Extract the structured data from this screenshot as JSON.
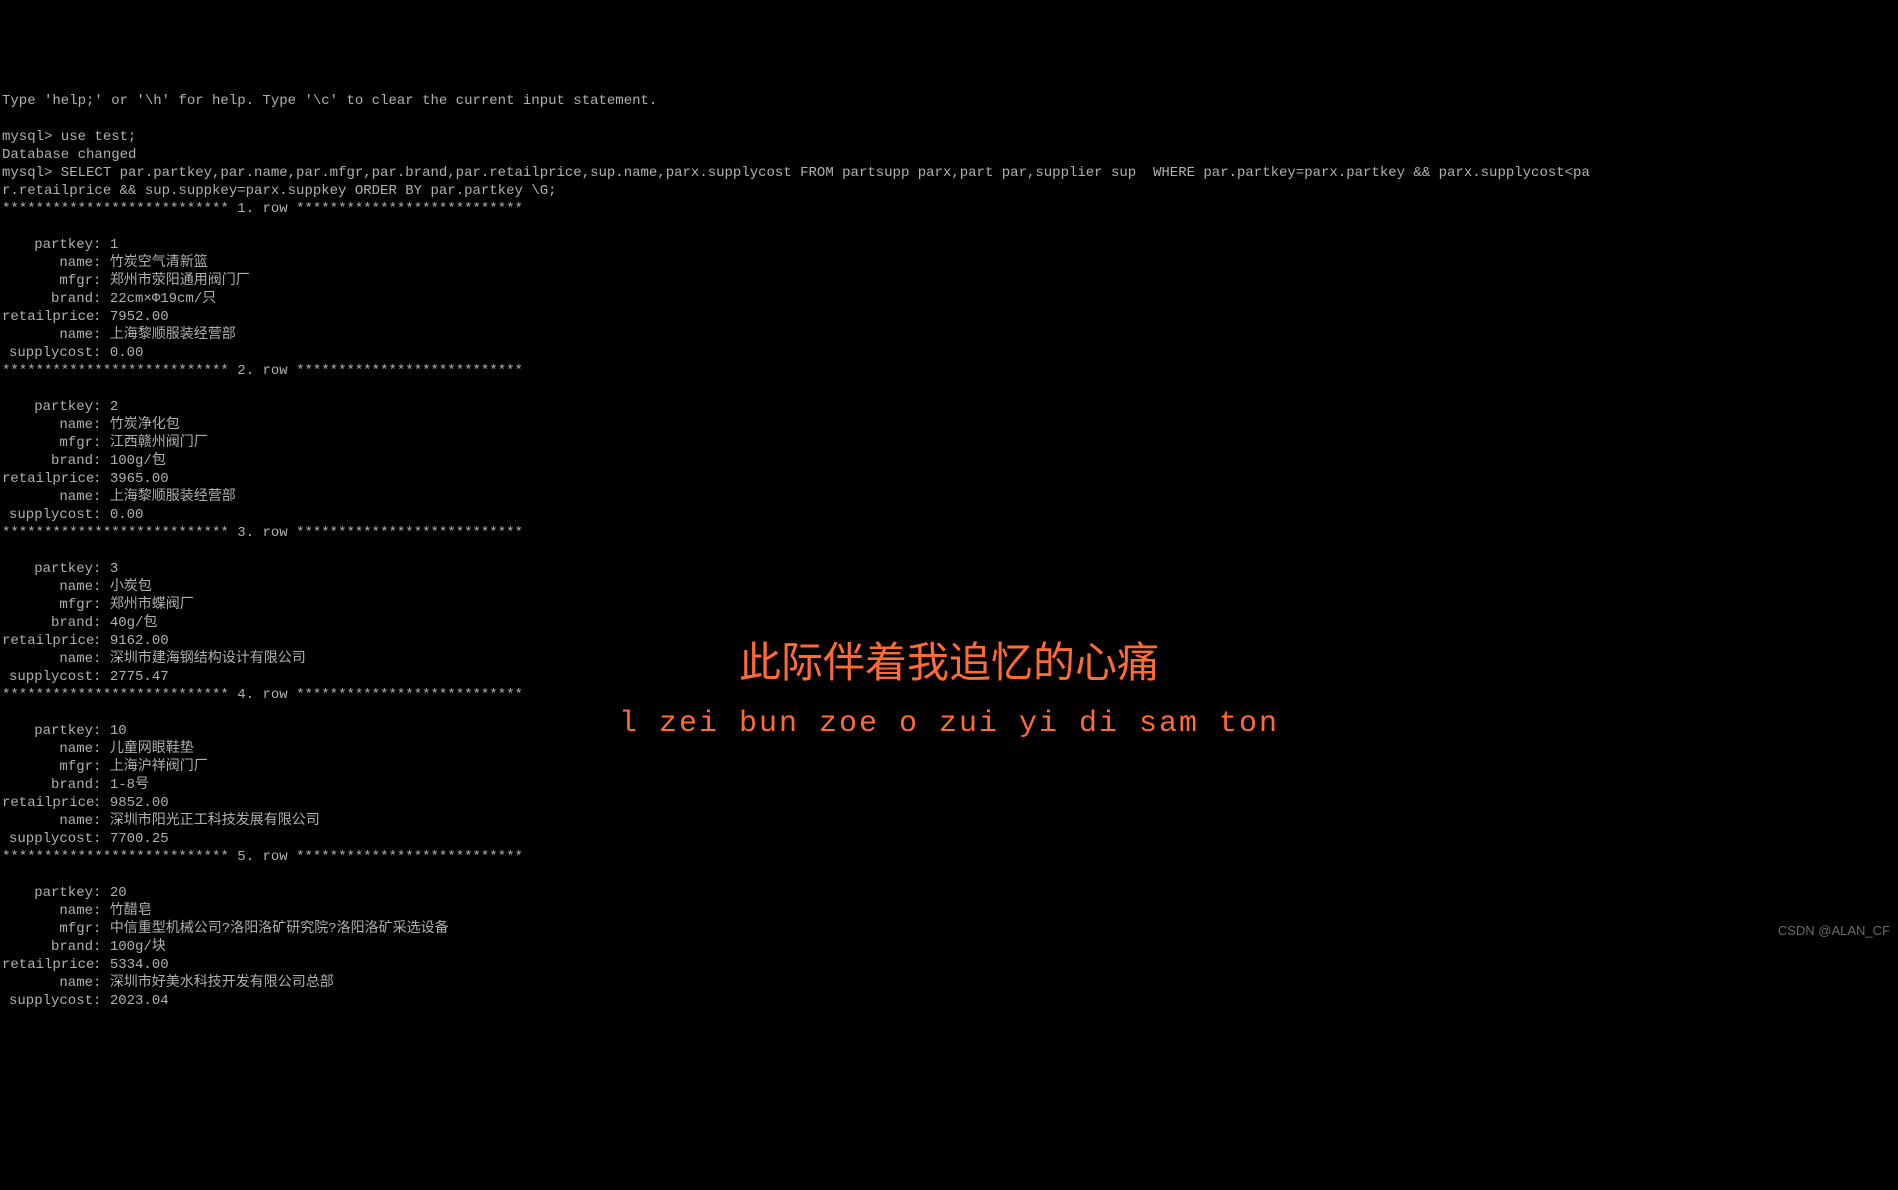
{
  "help_line": "Type 'help;' or '\\h' for help. Type '\\c' to clear the current input statement.",
  "blank": "",
  "prompt1": "mysql> use test;",
  "db_changed": "Database changed",
  "query_line1": "mysql> SELECT par.partkey,par.name,par.mfgr,par.brand,par.retailprice,sup.name,parx.supplycost FROM partsupp parx,part par,supplier sup  WHERE par.partkey=parx.partkey && parx.supplycost<pa",
  "query_line2": "r.retailprice && sup.suppkey=parx.suppkey ORDER BY par.partkey \\G;",
  "sep_prefix": "***************************",
  "sep_suffix": " ***************************",
  "row_label": ". row",
  "rows": [
    {
      "n": "1",
      "partkey": "1",
      "name": "竹炭空气清新篮",
      "mfgr": "郑州市荥阳通用阀门厂",
      "brand": "22cm×Φ19cm/只",
      "retailprice": "7952.00",
      "sup_name": "上海黎顺服装经营部",
      "supplycost": "0.00"
    },
    {
      "n": "2",
      "partkey": "2",
      "name": "竹炭净化包",
      "mfgr": "江西赣州阀门厂",
      "brand": "100g/包",
      "retailprice": "3965.00",
      "sup_name": "上海黎顺服装经营部",
      "supplycost": "0.00"
    },
    {
      "n": "3",
      "partkey": "3",
      "name": "小炭包",
      "mfgr": "郑州市蝶阀厂",
      "brand": "40g/包",
      "retailprice": "9162.00",
      "sup_name": "深圳市建海钢结构设计有限公司",
      "supplycost": "2775.47"
    },
    {
      "n": "4",
      "partkey": "10",
      "name": "儿童网眼鞋垫",
      "mfgr": "上海沪祥阀门厂",
      "brand": "1-8号",
      "retailprice": "9852.00",
      "sup_name": "深圳市阳光正工科技发展有限公司",
      "supplycost": "7700.25"
    },
    {
      "n": "5",
      "partkey": "20",
      "name": "竹醋皂",
      "mfgr": "中信重型机械公司?洛阳洛矿研究院?洛阳洛矿采选设备",
      "brand": "100g/块",
      "retailprice": "5334.00",
      "sup_name": "深圳市好美水科技开发有限公司总部",
      "supplycost": "2023.04"
    }
  ],
  "labels": {
    "partkey": "partkey",
    "name": "name",
    "mfgr": "mfgr",
    "brand": "brand",
    "retailprice": "retailprice",
    "supplycost": "supplycost"
  },
  "subtitle": {
    "line1": "此际伴着我追忆的心痛",
    "line2": "l zei bun zoe o zui yi di sam ton"
  },
  "watermark": "CSDN @ALAN_CF"
}
